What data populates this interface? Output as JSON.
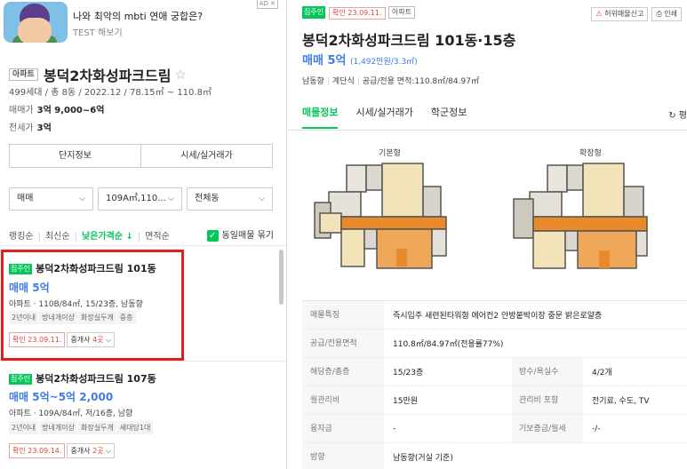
{
  "ad": {
    "title": "나와 최악의 mbti 연애 궁합은?",
    "subtitle": "TEST 해보기",
    "badge": "AD ✕"
  },
  "complex": {
    "tag": "아파트",
    "name": "봉덕2차화성파크드림",
    "star": "☆",
    "info": "499세대 / 총 8동 / 2022.12 / 78.15㎡ ~ 110.8㎡",
    "sale_label": "매매가",
    "sale_value": "3억 9,000~6억",
    "jeonse_label": "전세가",
    "jeonse_value": "3억"
  },
  "buttons": {
    "info": "단지정보",
    "market": "시세/실거래가"
  },
  "filters": {
    "trade": "매매",
    "area": "109A㎡,110...",
    "dong": "전체동"
  },
  "sorts": {
    "rank": "랭킹순",
    "latest": "최신순",
    "low_price": "낮은가격순 ↓",
    "area": "면적순",
    "same_group": "동일매물 묶기",
    "check": "✓"
  },
  "listings": [
    {
      "badge": "집주인",
      "title": "봉덕2차화성파크드림 101동",
      "price": "매매 5억",
      "spec": "아파트 · 110B/84㎡, 15/23층, 남동향",
      "chips": [
        "2년이내",
        "방네개이상",
        "화장실두개",
        "중층"
      ],
      "confirm": "확인 23.09.11.",
      "agent_prefix": "중개사 ",
      "agent_count": "4곳",
      "agent_chev": "⌵"
    },
    {
      "badge": "집주인",
      "title": "봉덕2차화성파크드림 107동",
      "price": "매매 5억~5억 2,000",
      "spec": "아파트 · 109A/84㎡, 저/16층, 남향",
      "chips": [
        "2년이내",
        "방네개이상",
        "화장실두개",
        "세대당1대"
      ],
      "confirm": "확인 23.09.14.",
      "agent_prefix": "중개사 ",
      "agent_count": "2곳",
      "agent_chev": "⌵"
    }
  ],
  "detail": {
    "badge": "집주인",
    "confirm": "확인 23.09.11.",
    "type_tag": "아파트",
    "report": "허위매물신고",
    "print": "인쇄",
    "title": "봉덕2차화성파크드림 101동·15층",
    "price": "매매 5억",
    "price_per": "(1,492만원/3.3㎡)",
    "meta": {
      "direction": "남동향",
      "stairs": "계단식",
      "area": "공급/전용 면적:110.8㎡/84.97㎡"
    },
    "tabs": [
      "매물정보",
      "시세/실거래가",
      "학군정보"
    ],
    "refresh": "↻ 평",
    "plan_basic": "기본형",
    "plan_ext": "확장형",
    "table": {
      "feature_k": "매물특징",
      "feature_v": "즉시입주 새련된타워형 에어컨2 안방붙박이장 중문 밝은로얄층",
      "area_k": "공급/전용면적",
      "area_v": "110.8㎡/84.97㎡(전용률77%)",
      "floor_k": "해당층/총층",
      "floor_v": "15/23층",
      "rooms_k": "방수/욕실수",
      "rooms_v": "4/2개",
      "fee_k": "월관리비",
      "fee_v": "15만원",
      "fee_inc_k": "관리비 포함",
      "fee_inc_v": "전기료, 수도, TV",
      "loan_k": "융자금",
      "loan_v": "-",
      "deposit_k": "기보증금/월세",
      "deposit_v": "-/-",
      "dir_k": "방향",
      "dir_v": "남동향(거실 기준)"
    }
  }
}
